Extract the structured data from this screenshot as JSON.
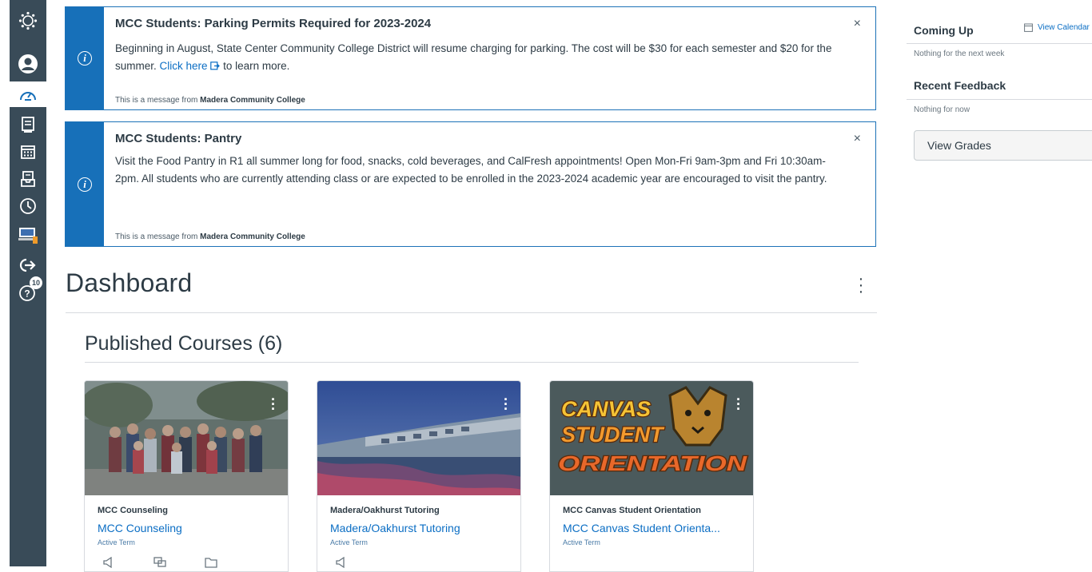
{
  "nav": {
    "notifications_badge": "10"
  },
  "announcements": [
    {
      "title": "MCC Students: Parking Permits Required for 2023-2024",
      "body_before": "Beginning in August, State Center Community College District will resume charging for parking. The cost will be $30 for each semester and $20 for the summer. ",
      "link": "Click here",
      "body_after": " to learn more.",
      "from_prefix": "This is a message from ",
      "from_org": "Madera Community College",
      "close": "×"
    },
    {
      "title": "MCC Students: Pantry",
      "body": "Visit the Food Pantry in R1 all summer long for food, snacks, cold beverages, and CalFresh appointments! Open Mon-Fri 9am-3pm and Fri 10:30am-2pm. All students who are currently attending class or are expected to be enrolled in the 2023-2024 academic year are encouraged to visit the pantry.",
      "from_prefix": "This is a message from ",
      "from_org": "Madera Community College",
      "close": "×"
    }
  ],
  "dashboard": {
    "title": "Dashboard",
    "published_heading": "Published Courses (6)"
  },
  "courses": [
    {
      "short": "MCC Counseling",
      "name": "MCC Counseling",
      "term": "Active Term"
    },
    {
      "short": "Madera/Oakhurst Tutoring",
      "name": "Madera/Oakhurst Tutoring",
      "term": "Active Term"
    },
    {
      "short": "MCC Canvas Student Orientation",
      "name": "MCC Canvas Student Orienta...",
      "term": "Active Term",
      "logo_lines": [
        "CANVAS",
        "STUDENT",
        "ORIENTATION"
      ]
    }
  ],
  "sidebar": {
    "coming_up": "Coming Up",
    "view_calendar": "View Calendar",
    "coming_up_empty": "Nothing for the next week",
    "recent_feedback": "Recent Feedback",
    "feedback_empty": "Nothing for now",
    "view_grades": "View Grades"
  },
  "colors": {
    "nav_bg": "#394b58",
    "accent": "#1770b9",
    "link": "#0b6ec4"
  }
}
